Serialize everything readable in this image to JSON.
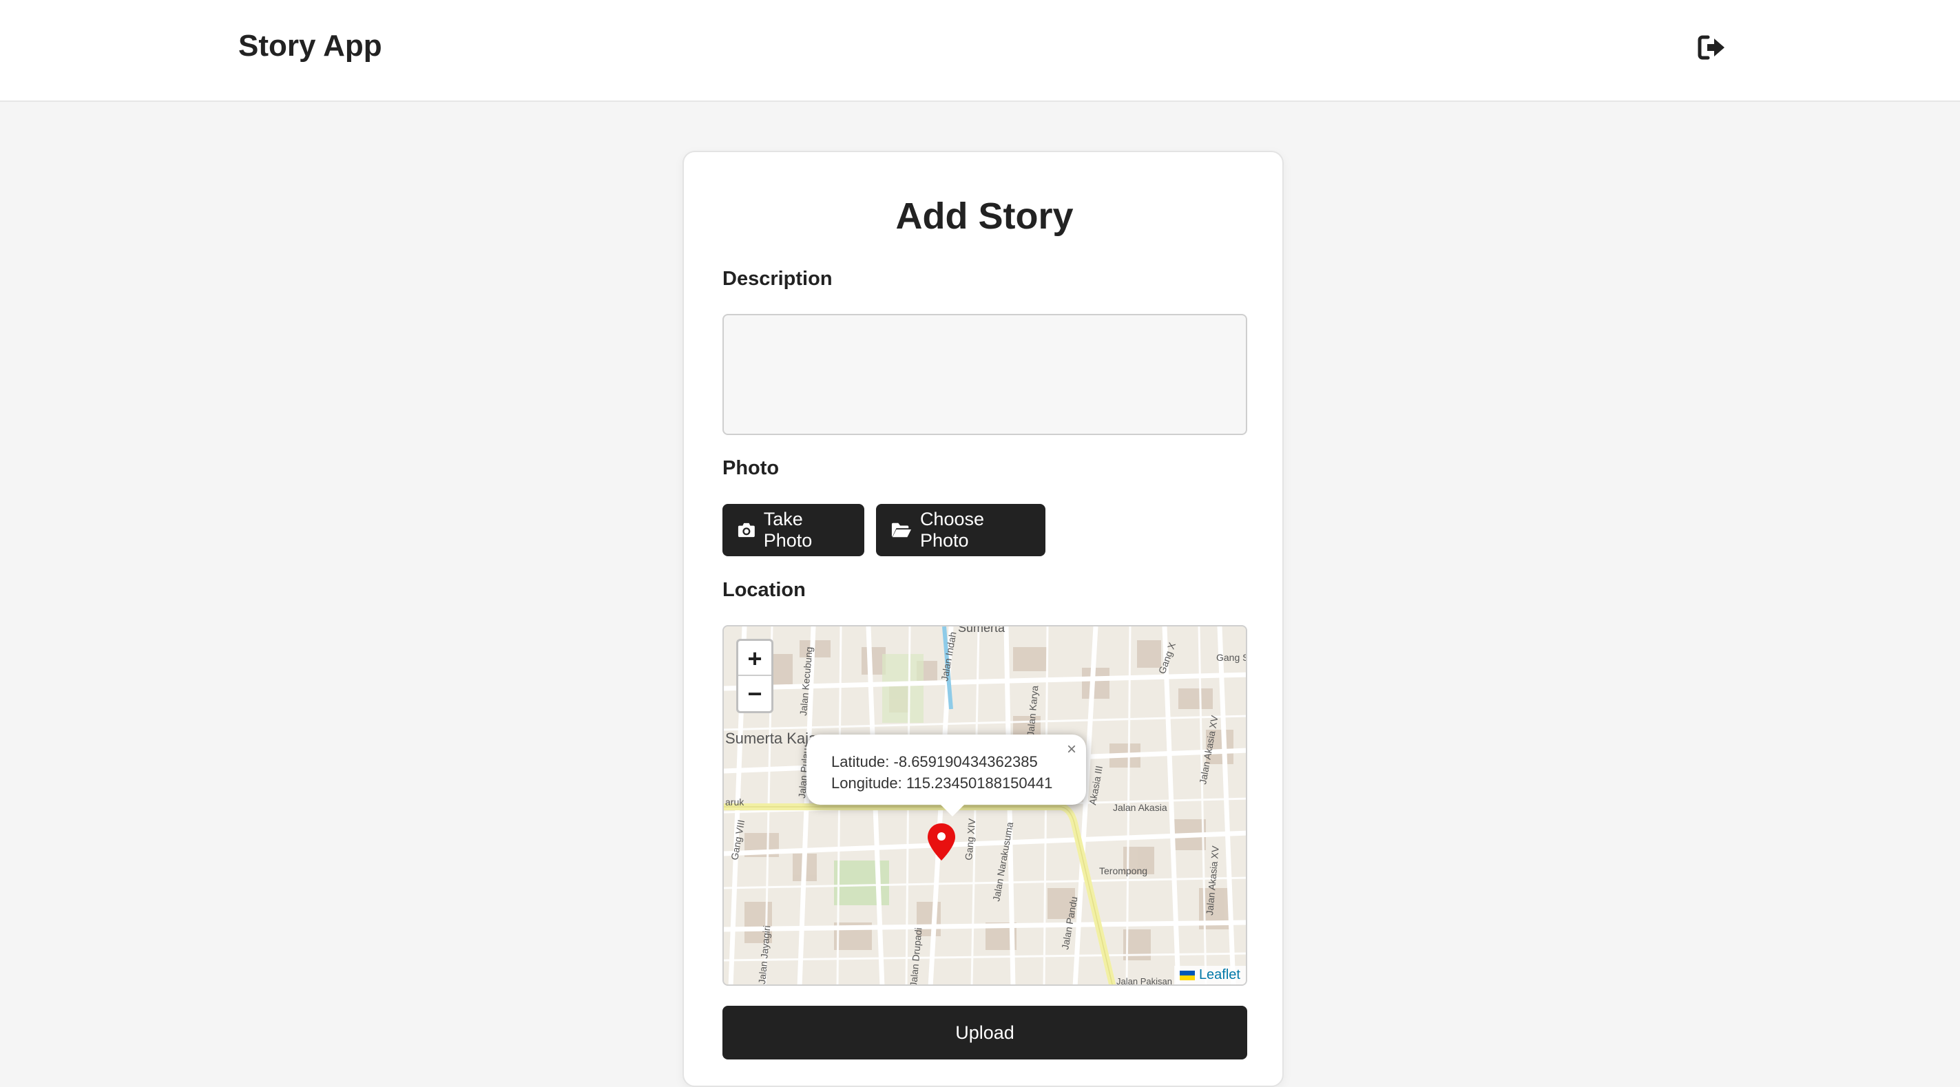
{
  "header": {
    "brand": "Story App",
    "logout_icon": "logout-icon"
  },
  "form": {
    "title": "Add Story",
    "description_label": "Description",
    "description_value": "",
    "photo_label": "Photo",
    "take_photo_label": "Take Photo",
    "choose_photo_label": "Choose Photo",
    "location_label": "Location",
    "upload_label": "Upload"
  },
  "map": {
    "zoom_in": "+",
    "zoom_out": "−",
    "popup": {
      "latitude": "Latitude: -8.659190434362385",
      "longitude": "Longitude: 115.23450188150441",
      "close": "×"
    },
    "attribution": "Leaflet",
    "street_labels": [
      "Sumerta",
      "Jalan Kecubung",
      "Jalan Indah",
      "Jalan Pulau",
      "Gang X",
      "Gang S",
      "Jalan Akasia XV",
      "Jalan Akasia",
      "Akasia III",
      "Jalan Karya",
      "Sumerta Kaja",
      "Gang XIV",
      "Jalan Narakusuma",
      "Terompong",
      "Jalan Akasia XV",
      "Jalan Jayagiri",
      "Jalan Drupadi",
      "Jalan Pakisan",
      "Jalan Pandu",
      "aruk",
      "Gang VIII"
    ],
    "colors": {
      "marker": "#e81010",
      "major_road": "#f2f0a4",
      "minor_road": "#ffffff",
      "land": "#efebe3",
      "building": "#d9cdbf"
    }
  }
}
